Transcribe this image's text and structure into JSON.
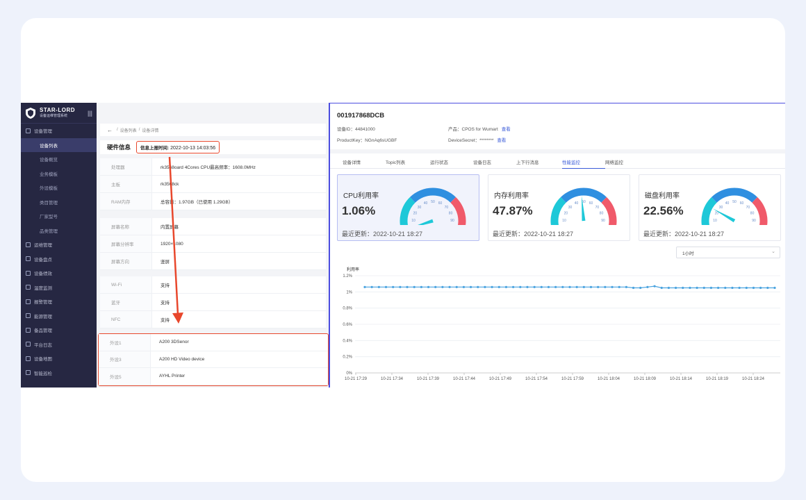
{
  "brand": {
    "name": "STAR-LORD",
    "subtitle": "设备运维管理系统"
  },
  "sidebar": {
    "items": [
      {
        "label": "设备管理",
        "type": "group"
      },
      {
        "label": "设备列表",
        "type": "child",
        "active": true
      },
      {
        "label": "设备概览",
        "type": "child"
      },
      {
        "label": "业务模板",
        "type": "child"
      },
      {
        "label": "外设模板",
        "type": "child"
      },
      {
        "label": "类目管理",
        "type": "child"
      },
      {
        "label": "厂家型号",
        "type": "child"
      },
      {
        "label": "品类管理",
        "type": "child"
      },
      {
        "label": "运维管理",
        "type": "group"
      },
      {
        "label": "设备盘点",
        "type": "group"
      },
      {
        "label": "设备绩效",
        "type": "group"
      },
      {
        "label": "温度监测",
        "type": "group"
      },
      {
        "label": "报警管理",
        "type": "group"
      },
      {
        "label": "能源管理",
        "type": "group"
      },
      {
        "label": "备品管理",
        "type": "group"
      },
      {
        "label": "平台日志",
        "type": "group"
      },
      {
        "label": "设备地图",
        "type": "group"
      },
      {
        "label": "智能巡检",
        "type": "group"
      }
    ]
  },
  "breadcrumb": {
    "items": [
      "设备列表",
      "设备详情"
    ]
  },
  "hardware": {
    "title": "硬件信息",
    "report_label": "信息上报时间:",
    "report_time": "2022-10-13 14:03:56",
    "rows": [
      {
        "k": "处理器",
        "v": "rk3568oard 4Cores CPU最高频率：1608.0MHz"
      },
      {
        "k": "主板",
        "v": "rk3568ck"
      },
      {
        "k": "RAM内存",
        "v": "总容量：1.97GB（已使用 1.29GB）"
      }
    ],
    "screen_rows": [
      {
        "k": "屏幕名称",
        "v": "内置屏幕"
      },
      {
        "k": "屏幕分辨率",
        "v": "1920×1080"
      },
      {
        "k": "屏幕方向",
        "v": "竖屏"
      }
    ],
    "conn_rows": [
      {
        "k": "Wi-Fi",
        "v": "支持"
      },
      {
        "k": "蓝牙",
        "v": "支持"
      },
      {
        "k": "NFC",
        "v": "支持"
      }
    ],
    "peripherals": [
      {
        "k": "外设1",
        "v": "A200 3DSenor"
      },
      {
        "k": "外设3",
        "v": "A200 HD Video device"
      },
      {
        "k": "外设5",
        "v": "AYHL Printer"
      }
    ]
  },
  "device": {
    "id_title": "001917868DCB",
    "device_id_label": "设备ID：",
    "device_id": "44841000",
    "product_label": "产品：",
    "product": "CPOS for Wumart",
    "view_label": "查看",
    "productkey_label": "ProductKey：",
    "productkey": "NGnAq6sUGBF",
    "secret_label": "DeviceSecret：",
    "secret": "********"
  },
  "tabs": [
    {
      "label": "设备详情"
    },
    {
      "label": "Topic列表"
    },
    {
      "label": "运行状态"
    },
    {
      "label": "设备日志"
    },
    {
      "label": "上下行消息"
    },
    {
      "label": "性能监控",
      "active": true
    },
    {
      "label": "网络监控"
    }
  ],
  "gauges": [
    {
      "label": "CPU利用率",
      "value": "1.06%",
      "percent": 1.06,
      "updated": "最近更新：2022-10-21 18:27",
      "selected": true
    },
    {
      "label": "内存利用率",
      "value": "47.87%",
      "percent": 47.87,
      "updated": "最近更新：2022-10-21 18:27",
      "selected": false
    },
    {
      "label": "磁盘利用率",
      "value": "22.56%",
      "percent": 22.56,
      "updated": "最近更新：2022-10-21 18:27",
      "selected": false
    }
  ],
  "gauge_ticks": [
    "0",
    "10",
    "20",
    "30",
    "40",
    "50",
    "60",
    "70",
    "80",
    "90",
    "100"
  ],
  "range_select": {
    "value": "1小时"
  },
  "colors": {
    "accent": "#3a5bd9",
    "gauge_cyan": "#1ec8d8",
    "gauge_blue": "#2f8fe0",
    "gauge_red": "#f05a6a",
    "line": "#4aa3df",
    "highlight": "#e8472c"
  },
  "chart_data": {
    "type": "line",
    "ylabel": "利用率",
    "y_ticks": [
      "0%",
      "0.2%",
      "0.4%",
      "0.6%",
      "0.8%",
      "1%",
      "1.2%"
    ],
    "ylim": [
      0,
      1.2
    ],
    "x_ticks": [
      "10-21 17:29",
      "10-21 17:34",
      "10-21 17:39",
      "10-21 17:44",
      "10-21 17:49",
      "10-21 17:54",
      "10-21 17:59",
      "10-21 18:04",
      "10-21 18:09",
      "10-21 18:14",
      "10-21 18:19",
      "10-21 18:24"
    ],
    "series": [
      {
        "values": [
          1.06,
          1.06,
          1.06,
          1.06,
          1.06,
          1.06,
          1.06,
          1.06,
          1.06,
          1.06,
          1.06,
          1.06,
          1.06,
          1.06,
          1.06,
          1.06,
          1.06,
          1.06,
          1.06,
          1.06,
          1.06,
          1.06,
          1.06,
          1.06,
          1.06,
          1.06,
          1.06,
          1.06,
          1.06,
          1.06,
          1.06,
          1.06,
          1.06,
          1.06,
          1.06,
          1.06,
          1.06,
          1.06,
          1.05,
          1.05,
          1.06,
          1.07,
          1.05,
          1.05,
          1.05,
          1.05,
          1.05,
          1.05,
          1.05,
          1.05,
          1.05,
          1.05,
          1.05,
          1.05,
          1.05,
          1.05,
          1.05,
          1.05,
          1.05
        ]
      }
    ],
    "grid": true
  }
}
